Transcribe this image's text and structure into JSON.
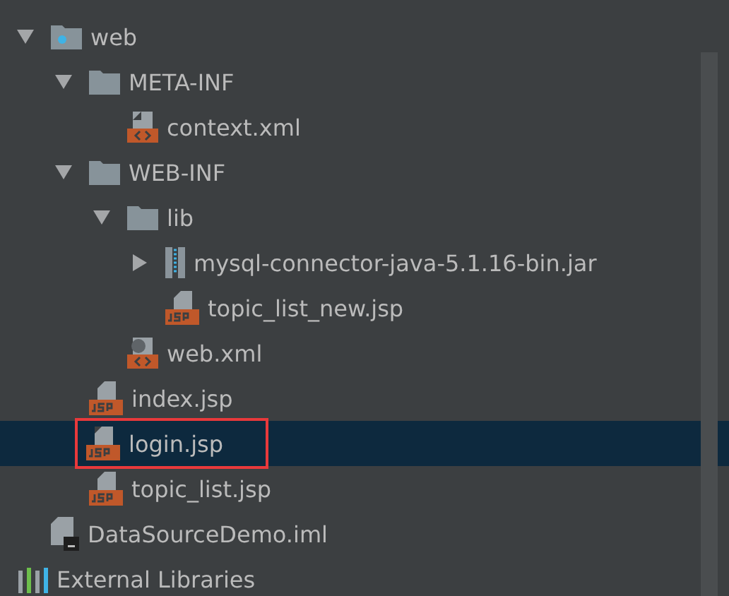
{
  "tree": [
    {
      "label": "web",
      "kind": "webfolder",
      "expanded": true,
      "selected": false,
      "children": [
        {
          "label": "META-INF",
          "kind": "folder",
          "expanded": true,
          "selected": false,
          "children": [
            {
              "label": "context.xml",
              "kind": "xml",
              "selected": false
            }
          ]
        },
        {
          "label": "WEB-INF",
          "kind": "folder",
          "expanded": true,
          "selected": false,
          "children": [
            {
              "label": "lib",
              "kind": "folder",
              "expanded": true,
              "selected": false,
              "children": [
                {
                  "label": "mysql-connector-java-5.1.16-bin.jar",
                  "kind": "jar",
                  "expanded": false,
                  "selected": false
                },
                {
                  "label": "topic_list_new.jsp",
                  "kind": "jsp",
                  "selected": false
                }
              ]
            },
            {
              "label": "web.xml",
              "kind": "webxml",
              "selected": false
            }
          ]
        },
        {
          "label": "index.jsp",
          "kind": "jsp",
          "selected": false
        },
        {
          "label": "login.jsp",
          "kind": "jsp",
          "selected": true,
          "annotated": true
        },
        {
          "label": "topic_list.jsp",
          "kind": "jsp",
          "selected": false
        }
      ]
    },
    {
      "label": "DataSourceDemo.iml",
      "kind": "iml",
      "selected": false
    }
  ],
  "external_libraries": {
    "label": "External Libraries"
  }
}
